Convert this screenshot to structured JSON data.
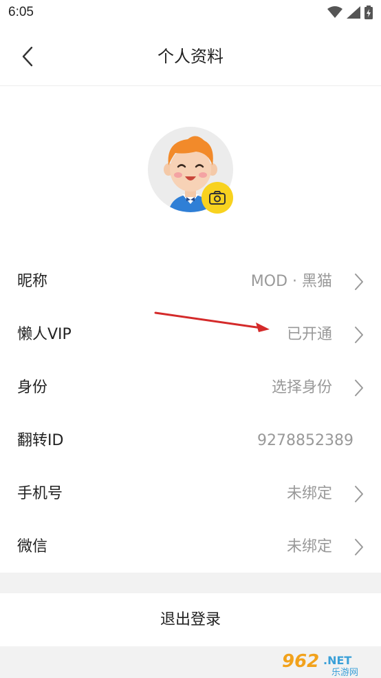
{
  "status_bar": {
    "time": "6:05",
    "icons": [
      "wifi-icon",
      "signal-icon",
      "battery-charging-icon"
    ]
  },
  "header": {
    "title": "个人资料",
    "back_icon": "chevron-left-icon"
  },
  "profile": {
    "avatar": "cartoon-boy-avatar",
    "camera_icon": "camera-icon",
    "accent_color": "#f8d21f"
  },
  "rows": [
    {
      "label": "昵称",
      "value": "MOD · 黑猫",
      "has_arrow": true
    },
    {
      "label": "懒人VIP",
      "value": "已开通",
      "has_arrow": true
    },
    {
      "label": "身份",
      "value": "选择身份",
      "has_arrow": true
    },
    {
      "label": "翻转ID",
      "value": "9278852389",
      "has_arrow": false
    },
    {
      "label": "手机号",
      "value": "未绑定",
      "has_arrow": true
    },
    {
      "label": "微信",
      "value": "未绑定",
      "has_arrow": true
    }
  ],
  "logout_label": "退出登录",
  "watermark": {
    "brand": "962",
    "suffix": ".NET",
    "sub": "乐游网"
  },
  "colors": {
    "annotation_arrow": "#d42a2a",
    "value_text": "#999999",
    "divider_bg": "#f2f2f2"
  }
}
